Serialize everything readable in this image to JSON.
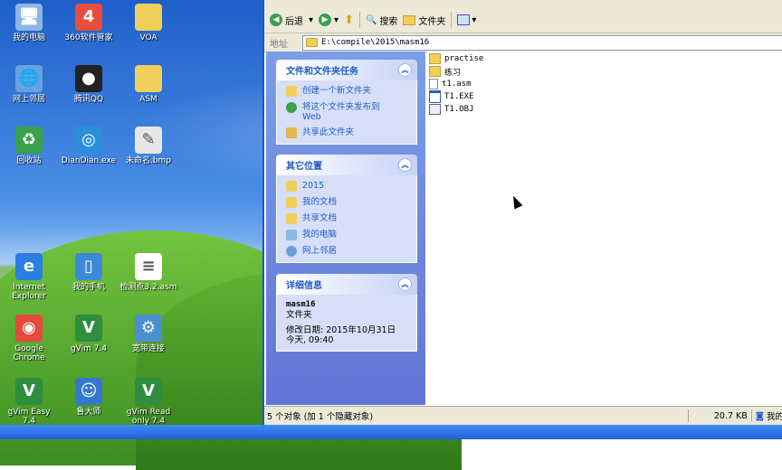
{
  "desktop": {
    "icons": [
      {
        "label": "我的电脑",
        "icon": "my-computer-icon",
        "glyph": "🖥",
        "color": "#8db6e6"
      },
      {
        "label": "360软件管家",
        "icon": "360-software-manager-icon",
        "glyph": "4",
        "color": "#e84d3d"
      },
      {
        "label": "VOA",
        "icon": "folder-icon",
        "glyph": "",
        "color": "#f1cf5b"
      },
      {
        "label": "网上邻居",
        "icon": "network-places-icon",
        "glyph": "🌐",
        "color": "#6aa0e0"
      },
      {
        "label": "腾讯QQ",
        "icon": "qq-icon",
        "glyph": "●",
        "color": "#222222"
      },
      {
        "label": "ASM",
        "icon": "folder-icon",
        "glyph": "",
        "color": "#f1cf5b"
      },
      {
        "label": "回收站",
        "icon": "recycle-bin-icon",
        "glyph": "♻",
        "color": "#3aa04a"
      },
      {
        "label": "DianDian.exe",
        "icon": "diandian-icon",
        "glyph": "◎",
        "color": "#2a8fd8"
      },
      {
        "label": "未命名.bmp",
        "icon": "paint-icon",
        "glyph": "✎",
        "color": "#e6e6e6"
      },
      {
        "label": "Internet Explorer",
        "icon": "internet-explorer-icon",
        "glyph": "e",
        "color": "#2a7de1"
      },
      {
        "label": "我的手机",
        "icon": "phone-icon",
        "glyph": "▯",
        "color": "#3b8ad8"
      },
      {
        "label": "检测点3.2.asm",
        "icon": "text-file-icon",
        "glyph": "≡",
        "color": "#ffffff"
      },
      {
        "label": "Google Chrome",
        "icon": "chrome-icon",
        "glyph": "◉",
        "color": "#e34b3b"
      },
      {
        "label": "gVim 7.4",
        "icon": "gvim-icon",
        "glyph": "V",
        "color": "#2f8d3f"
      },
      {
        "label": "宽带连接",
        "icon": "broadband-icon",
        "glyph": "⚙",
        "color": "#4c8fd1"
      },
      {
        "label": "gVim Easy 7.4",
        "icon": "gvim-easy-icon",
        "glyph": "V",
        "color": "#2f8d3f"
      },
      {
        "label": "鲁大师",
        "icon": "ludashi-icon",
        "glyph": "☺",
        "color": "#3577d0"
      },
      {
        "label": "gVim Read only 7.4",
        "icon": "gvim-readonly-icon",
        "glyph": "V",
        "color": "#2f8d3f"
      }
    ]
  },
  "toolbar": {
    "back_label": "后退",
    "search_label": "搜索",
    "folders_label": "文件夹"
  },
  "address": {
    "label": "地址",
    "path": "E:\\compile\\2015\\masm16"
  },
  "tasks_panel": {
    "title": "文件和文件夹任务",
    "items": [
      "创建一个新文件夹",
      "将这个文件夹发布到 Web",
      "共享此文件夹"
    ]
  },
  "places_panel": {
    "title": "其它位置",
    "items": [
      "2015",
      "我的文档",
      "共享文档",
      "我的电脑",
      "网上邻居"
    ]
  },
  "details_panel": {
    "title": "详细信息",
    "name": "masm16",
    "type": "文件夹",
    "modified": "修改日期: 2015年10月31日",
    "time": "今天, 09:40"
  },
  "files": [
    {
      "name": "practise",
      "icon": "folder-icon"
    },
    {
      "name": "练习",
      "icon": "folder-icon"
    },
    {
      "name": "t1.asm",
      "icon": "text-file-icon"
    },
    {
      "name": "T1.EXE",
      "icon": "exe-file-icon"
    },
    {
      "name": "T1.OBJ",
      "icon": "obj-file-icon"
    }
  ],
  "status": {
    "objects": "5 个对象 (加 1 个隐藏对象)",
    "size": "20.7 KB",
    "location": "我的"
  }
}
